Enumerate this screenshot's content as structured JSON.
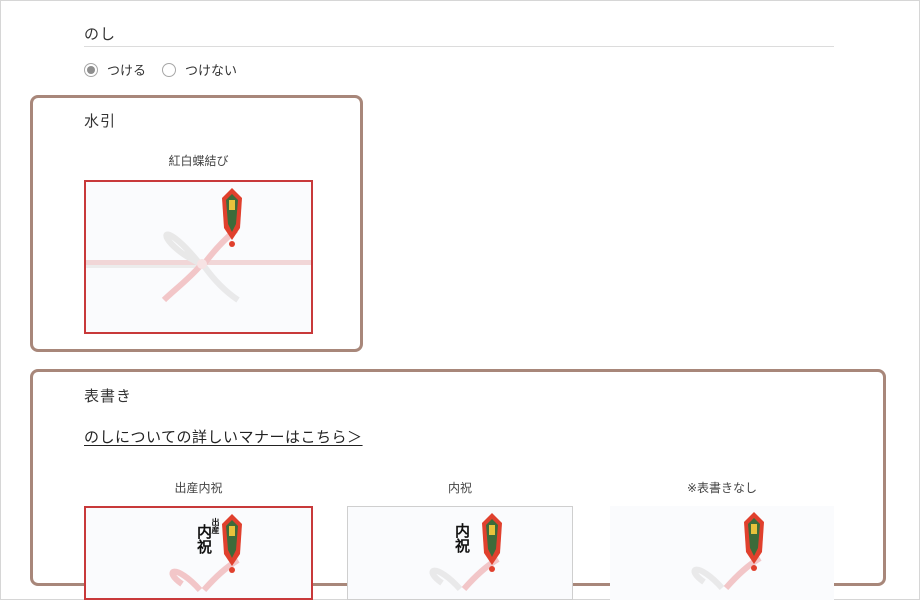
{
  "noshi": {
    "title": "のし",
    "options": [
      {
        "label": "つける",
        "selected": true
      },
      {
        "label": "つけない",
        "selected": false
      }
    ]
  },
  "mizuhiki": {
    "title": "水引",
    "items": [
      {
        "label": "紅白蝶結び",
        "selected": true
      }
    ]
  },
  "omotegaki": {
    "title": "表書き",
    "link_text": "のしについての詳しいマナーはこちら＞",
    "items": [
      {
        "label": "出産内祝",
        "small_text": "出産",
        "main_text": "内祝",
        "selected": true
      },
      {
        "label": "内祝",
        "main_text": "内祝",
        "selected": false
      },
      {
        "label": "※表書きなし",
        "selected": false
      }
    ]
  },
  "colors": {
    "accent_border": "#a8877a",
    "selected_border": "#c8393a",
    "ribbon_red": "#f2c6c8",
    "ribbon_white": "#e9e9ea",
    "noshi_red": "#e0402d",
    "noshi_gold": "#e8c23c",
    "noshi_green": "#3d6b3a"
  }
}
